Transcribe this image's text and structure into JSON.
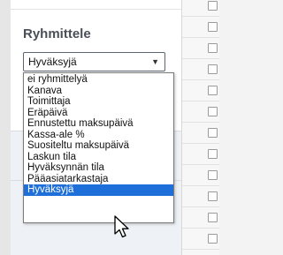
{
  "filter_panel": {
    "heading": "Ryhmittele",
    "selected_value": "Hyväksyjä",
    "options": [
      "ei ryhmittelyä",
      "Kanava",
      "Toimittaja",
      "Eräpäivä",
      "Ennustettu maksupäivä",
      "Kassa-ale %",
      "Suositeltu maksupäivä",
      "Laskun tila",
      "Hyväksynnän tila",
      "Pääasiatarkastaja",
      "Hyväksyjä"
    ],
    "highlighted_index": 10
  },
  "icons": {
    "dropdown_arrow": "chevron-down-icon",
    "cursor": "mouse-pointer-icon"
  },
  "colors": {
    "highlight": "#1e6fd9",
    "heading": "#4a4f57"
  }
}
